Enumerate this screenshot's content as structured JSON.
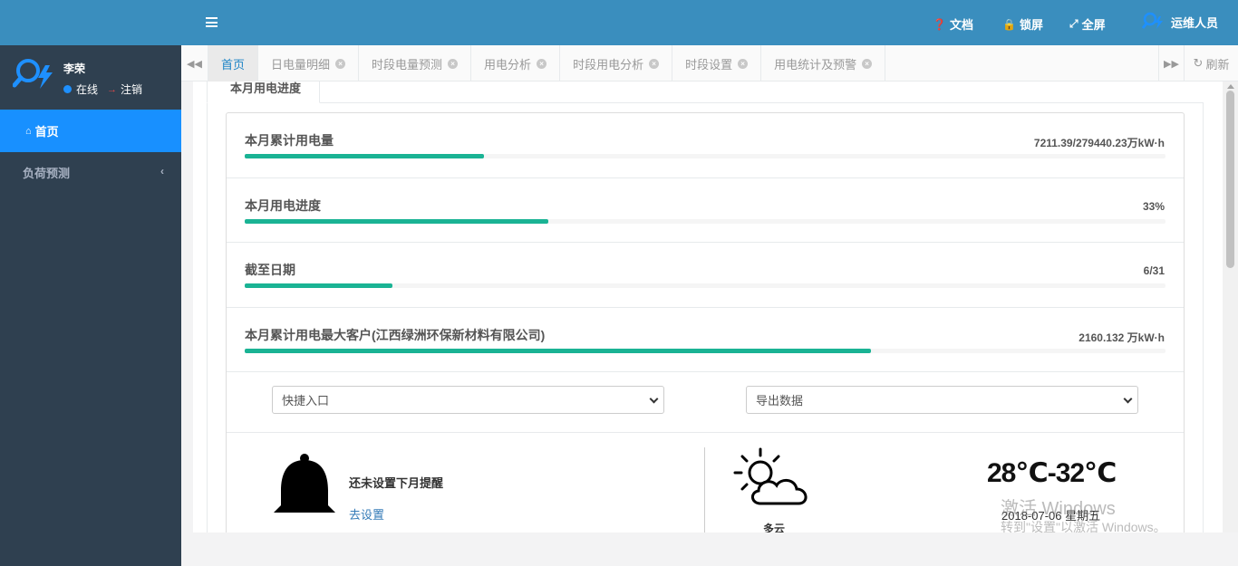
{
  "user": {
    "name": "李荣",
    "status": "在线",
    "logout": "注销"
  },
  "sidebar": {
    "items": [
      {
        "label": "首页"
      },
      {
        "label": "负荷预测"
      }
    ]
  },
  "header": {
    "docs": "文档",
    "lock": "锁屏",
    "fullscreen": "全屏",
    "ops": "运维人员"
  },
  "tabs": [
    {
      "label": "首页"
    },
    {
      "label": "日电量明细"
    },
    {
      "label": "时段电量预测"
    },
    {
      "label": "用电分析"
    },
    {
      "label": "时段用电分析"
    },
    {
      "label": "时段设置"
    },
    {
      "label": "用电统计及预警"
    }
  ],
  "refresh_label": "刷新",
  "panel": {
    "tab_title": "本月用电进度"
  },
  "stats": [
    {
      "label": "本月累计用电量",
      "value": "7211.39/279440.23万kW·h",
      "progress": 0.26
    },
    {
      "label": "本月用电进度",
      "value": "33%",
      "progress": 0.33
    },
    {
      "label": "截至日期",
      "value": "6/31",
      "progress": 0.16
    },
    {
      "label": "本月累计用电最大客户(江西绿洲环保新材料有限公司)",
      "value": "2160.132 万kW·h",
      "progress": 0.68
    }
  ],
  "selects": {
    "quick": "快捷入口",
    "export": "导出数据"
  },
  "reminder": {
    "text": "还未设置下月提醒",
    "link": "去设置"
  },
  "weather": {
    "condition": "多云",
    "temp": "28℃-32℃",
    "date": "2018-07-06 星期五"
  },
  "watermark": {
    "line1": "激活 Windows",
    "line2": "转到\"设置\"以激活 Windows。"
  },
  "colors": {
    "sidebar": "#2f4050",
    "header": "#3a8ebe",
    "active_nav": "#1890ff",
    "progress": "#1ab394"
  }
}
